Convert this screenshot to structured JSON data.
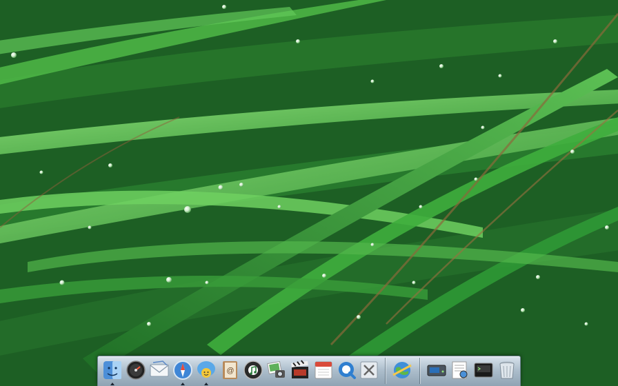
{
  "desktop": {
    "wallpaper": "green-grass-dew-wallpaper"
  },
  "dock": {
    "items": [
      {
        "icon": "finder-icon",
        "running": true
      },
      {
        "icon": "dashboard-icon",
        "running": false
      },
      {
        "icon": "mail-icon",
        "running": false
      },
      {
        "icon": "safari-icon",
        "running": true
      },
      {
        "icon": "ichat-icon",
        "running": true
      },
      {
        "icon": "address-book-icon",
        "running": false
      },
      {
        "icon": "itunes-icon",
        "running": false
      },
      {
        "icon": "iphoto-icon",
        "running": false
      },
      {
        "icon": "imovie-icon",
        "running": false
      },
      {
        "icon": "ical-icon",
        "running": false
      },
      {
        "icon": "quicktime-icon",
        "running": false
      },
      {
        "icon": "utilities-icon",
        "running": false
      },
      {
        "icon": "network-globe-icon",
        "running": false
      },
      {
        "icon": "hard-drive-icon",
        "running": false
      },
      {
        "icon": "preview-icon",
        "running": false
      },
      {
        "icon": "terminal-icon",
        "running": false
      },
      {
        "icon": "trash-icon",
        "running": false
      }
    ],
    "colors": {
      "dock_top": "#d9e3ec",
      "dock_bottom": "#8fa3b3"
    }
  }
}
